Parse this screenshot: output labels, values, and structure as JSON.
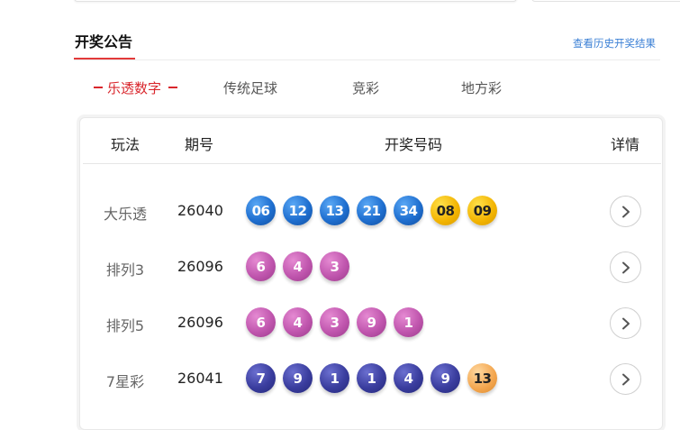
{
  "header": {
    "title": "开奖公告",
    "history_link": "查看历史开奖结果"
  },
  "tabs": [
    {
      "label": "乐透数字",
      "active": true
    },
    {
      "label": "传统足球",
      "active": false
    },
    {
      "label": "竞彩",
      "active": false
    },
    {
      "label": "地方彩",
      "active": false
    }
  ],
  "table": {
    "columns": [
      "玩法",
      "期号",
      "开奖号码",
      "详情"
    ],
    "rows": [
      {
        "name": "大乐透",
        "period": "26040",
        "balls": [
          {
            "n": "06",
            "color": "blue"
          },
          {
            "n": "12",
            "color": "blue"
          },
          {
            "n": "13",
            "color": "blue"
          },
          {
            "n": "21",
            "color": "blue"
          },
          {
            "n": "34",
            "color": "blue"
          },
          {
            "n": "08",
            "color": "yellow"
          },
          {
            "n": "09",
            "color": "yellow"
          }
        ]
      },
      {
        "name": "排列3",
        "period": "26096",
        "balls": [
          {
            "n": "6",
            "color": "pink"
          },
          {
            "n": "4",
            "color": "pink"
          },
          {
            "n": "3",
            "color": "pink"
          }
        ]
      },
      {
        "name": "排列5",
        "period": "26096",
        "balls": [
          {
            "n": "6",
            "color": "pink"
          },
          {
            "n": "4",
            "color": "pink"
          },
          {
            "n": "3",
            "color": "pink"
          },
          {
            "n": "9",
            "color": "pink"
          },
          {
            "n": "1",
            "color": "pink"
          }
        ]
      },
      {
        "name": "7星彩",
        "period": "26041",
        "balls": [
          {
            "n": "7",
            "color": "navy"
          },
          {
            "n": "9",
            "color": "navy"
          },
          {
            "n": "1",
            "color": "navy"
          },
          {
            "n": "1",
            "color": "navy"
          },
          {
            "n": "4",
            "color": "navy"
          },
          {
            "n": "9",
            "color": "navy"
          },
          {
            "n": "13",
            "color": "orange"
          }
        ]
      }
    ]
  },
  "colors": {
    "accent_red": "#d9262c",
    "link_blue": "#3a7fd5",
    "ball_blue": "#1f6fd0",
    "ball_yellow": "#f2b300",
    "ball_pink": "#c056ae",
    "ball_navy": "#3a3d9e",
    "ball_orange": "#f3a54d"
  },
  "icons": {
    "detail": "chevron-right-icon"
  }
}
